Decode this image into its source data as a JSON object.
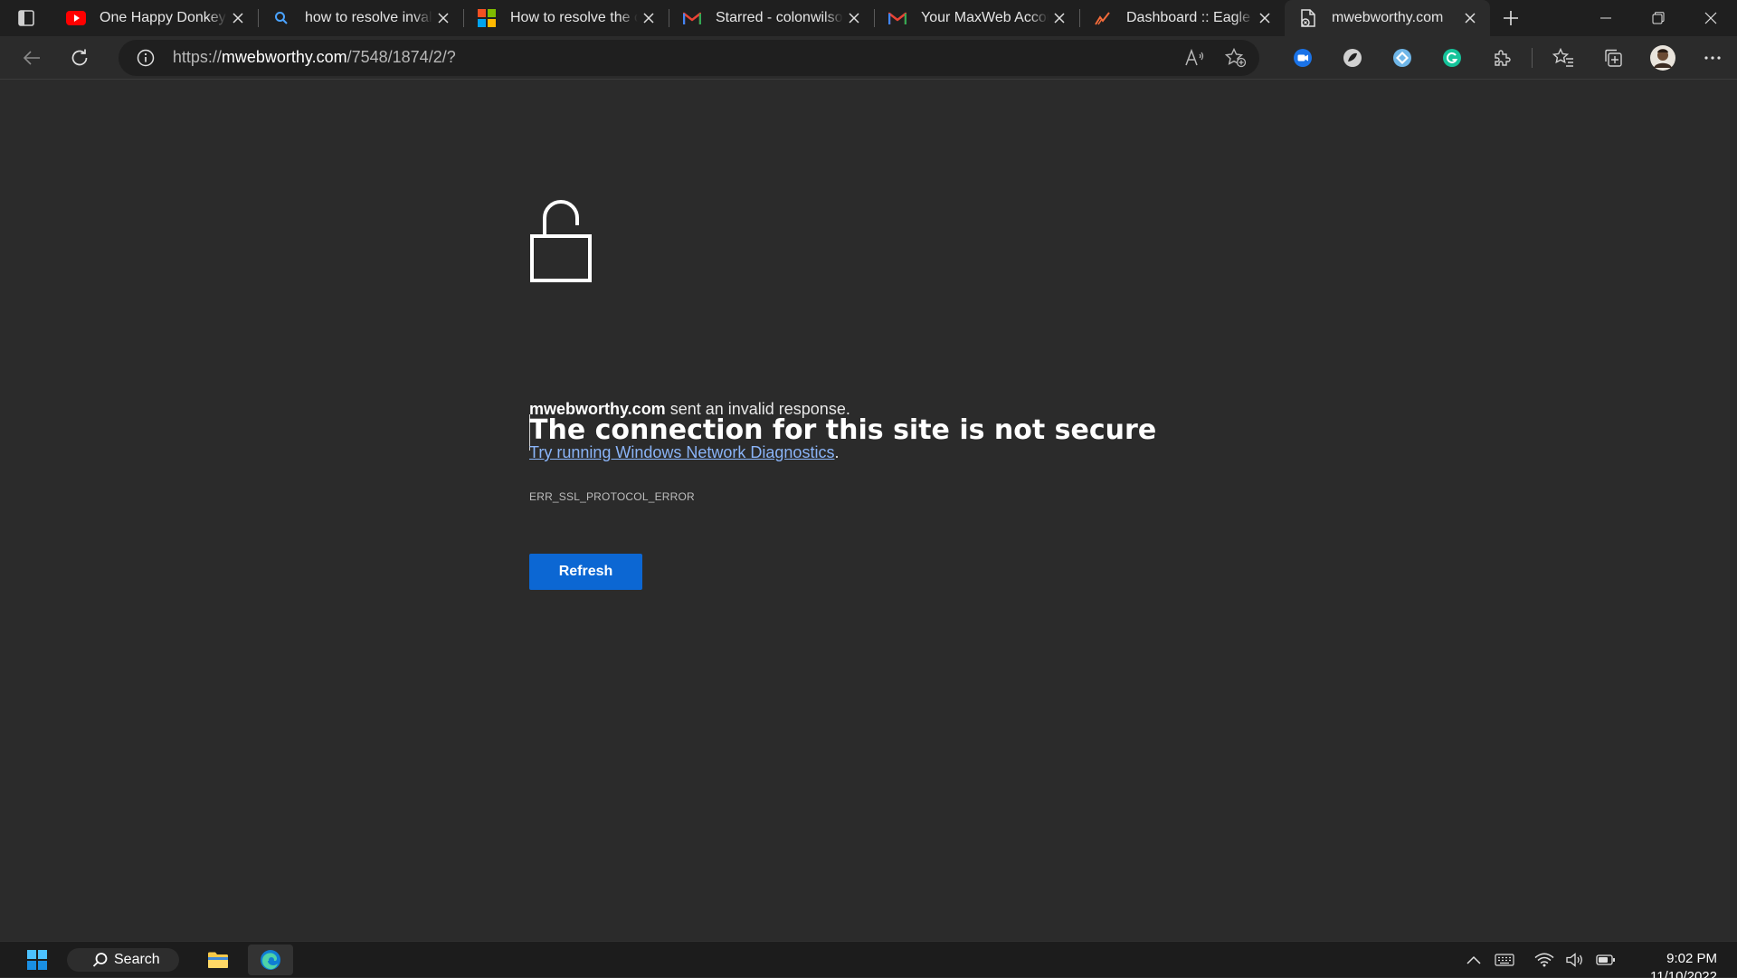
{
  "tabs": [
    {
      "title": "One Happy Donkey! -",
      "icon": "youtube-icon"
    },
    {
      "title": "how to resolve invalid",
      "icon": "search-icon"
    },
    {
      "title": "How to resolve the co",
      "icon": "microsoft-logo-icon"
    },
    {
      "title": "Starred - colonwilson",
      "icon": "gmail-icon"
    },
    {
      "title": "Your MaxWeb Accoun",
      "icon": "gmail-icon"
    },
    {
      "title": "Dashboard :: Eagle Ey",
      "icon": "chart-logo-icon"
    },
    {
      "title": "mwebworthy.com",
      "icon": "page-error-icon",
      "active": true
    }
  ],
  "address": {
    "scheme": "https://",
    "host": "mwebworthy.com",
    "path": "/7548/1874/2/?"
  },
  "error_page": {
    "heading": "The connection for this site is not secure",
    "site": "mwebworthy.com",
    "message": " sent an invalid response.",
    "link_text": "Try running Windows Network Diagnostics",
    "link_suffix": ".",
    "error_code": "ERR_SSL_PROTOCOL_ERROR",
    "refresh_label": "Refresh"
  },
  "taskbar": {
    "search_label": "Search",
    "time": "9:02 PM",
    "date": "11/10/2022"
  },
  "colors": {
    "accent_button": "#0c67d3",
    "link": "#8ab4f8",
    "page_bg": "#2b2b2b"
  }
}
